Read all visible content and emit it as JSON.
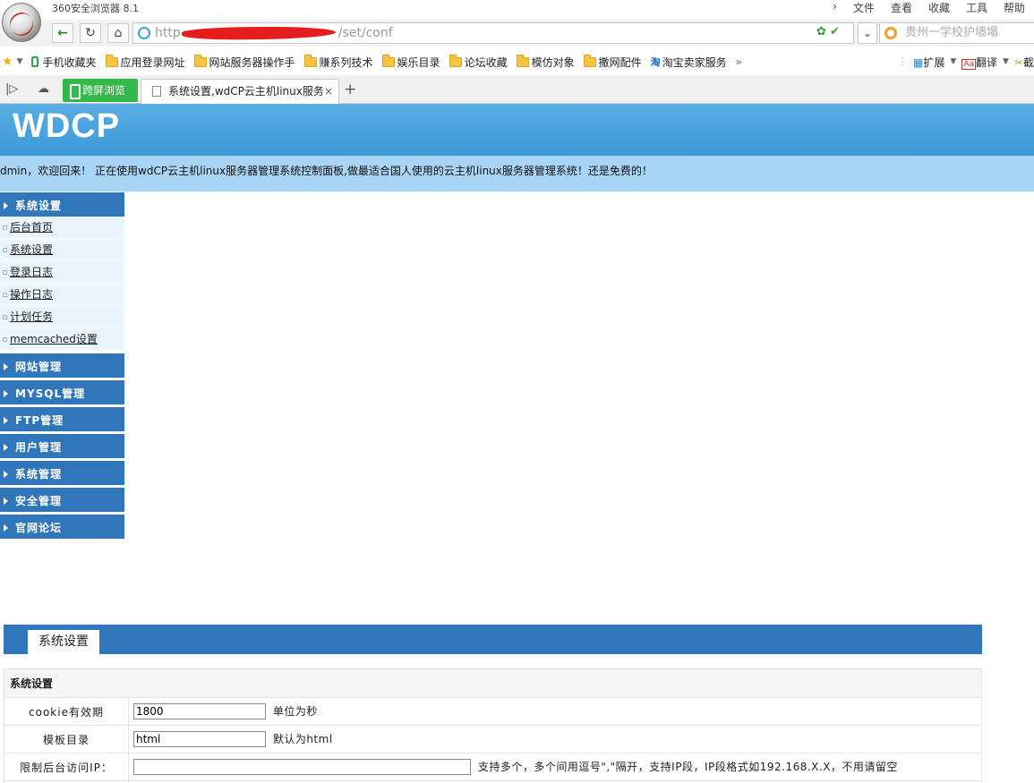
{
  "browser": {
    "title": "360安全浏览器 8.1",
    "menu": [
      "文件",
      "查看",
      "收藏",
      "工具",
      "帮助"
    ],
    "url_prefix": "http",
    "url_suffix": "/set/conf",
    "search_placeholder": "贵州一学校护墙塌",
    "bookmarks": [
      "手机收藏夹",
      "应用登录网址",
      "网站服务器操作手",
      "赚系列技术",
      "娱乐目录",
      "论坛收藏",
      "模仿对象",
      "撒网配件",
      "淘宝卖家服务"
    ],
    "bm_extend": "扩展",
    "bm_translate": "翻译",
    "bm_screenshot": "截",
    "green_button": "跨屏浏览",
    "tab_title": "系统设置,wdCP云主机linux服务"
  },
  "page": {
    "logo": "WDCP",
    "welcome": "dmin，欢迎回来！ 正在使用wdCP云主机linux服务器管理系统控制面板,做最适合国人使用的云主机linux服务器管理系统！还是免费的！",
    "sidebar": {
      "sections": [
        {
          "title": "系统设置",
          "items": [
            "后台首页",
            "系统设置",
            "登录日志",
            "操作日志",
            "计划任务",
            "memcached设置"
          ]
        },
        {
          "title": "网站管理"
        },
        {
          "title": "MYSQL管理"
        },
        {
          "title": "FTP管理"
        },
        {
          "title": "用户管理"
        },
        {
          "title": "系统管理"
        },
        {
          "title": "安全管理"
        },
        {
          "title": "官网论坛"
        }
      ]
    },
    "panel_tab": "系统设置",
    "form": {
      "caption": "系统设置",
      "cookie_label": "cookie有效期",
      "cookie_value": "1800",
      "cookie_hint": "单位为秒",
      "template_label": "模板目录",
      "template_value": "html",
      "template_hint": "默认为html",
      "ip_label": "限制后台访问IP：",
      "ip_value": "",
      "ip_hint": "支持多个，多个间用逗号\",\"隔开，支持IP段，IP段格式如192.168.X.X，不用请留空"
    }
  }
}
